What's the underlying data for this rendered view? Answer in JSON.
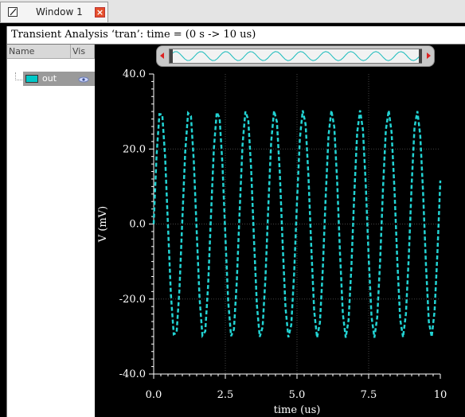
{
  "tab": {
    "label": "Window 1",
    "close_symbol": "×"
  },
  "window": {
    "title": "Transient Analysis ‘tran’: time = (0 s -> 10 us)"
  },
  "sidebar": {
    "columns": {
      "name": "Name",
      "vis": "Vis"
    },
    "traces": [
      {
        "name": "out",
        "color": "#00c7c7",
        "visible": true
      }
    ]
  },
  "icons": {
    "tab": "window-icon",
    "close": "close-icon",
    "visibility": "eye-icon"
  },
  "chart_data": {
    "type": "line",
    "title": "",
    "xlabel": "time (us)",
    "ylabel": "V (mV)",
    "xlim": [
      0,
      10
    ],
    "ylim": [
      -40,
      40
    ],
    "xticks": [
      0,
      2.5,
      5.0,
      7.5,
      10
    ],
    "xtick_labels": [
      "0.0",
      "2.5",
      "5.0",
      "7.5",
      "10"
    ],
    "yticks": [
      -40,
      -20,
      0,
      20,
      40
    ],
    "ytick_labels": [
      "-40.0",
      "-20.0",
      "0.0",
      "20.0",
      "40.0"
    ],
    "grid": true,
    "line_style": "dashed",
    "series": [
      {
        "name": "out",
        "color": "#22d3d3",
        "x": [
          0,
          0.1,
          0.2,
          0.3,
          0.4,
          0.5,
          0.6,
          0.7,
          0.8,
          0.9,
          1.0,
          1.1,
          1.2,
          1.3,
          1.4,
          1.5,
          1.6,
          1.7,
          1.8,
          1.9,
          2.0,
          2.1,
          2.2,
          2.3,
          2.4,
          2.5,
          2.6,
          2.7,
          2.8,
          2.9,
          3.0,
          3.1,
          3.2,
          3.3,
          3.4,
          3.5,
          3.6,
          3.7,
          3.8,
          3.9,
          4.0,
          4.1,
          4.2,
          4.3,
          4.4,
          4.5,
          4.6,
          4.7,
          4.8,
          4.9,
          5.0,
          5.1,
          5.2,
          5.3,
          5.4,
          5.5,
          5.6,
          5.7,
          5.8,
          5.9,
          6.0,
          6.1,
          6.2,
          6.3,
          6.4,
          6.5,
          6.6,
          6.7,
          6.8,
          6.9,
          7.0,
          7.1,
          7.2,
          7.3,
          7.4,
          7.5,
          7.6,
          7.7,
          7.8,
          7.9,
          8.0,
          8.1,
          8.2,
          8.3,
          8.4,
          8.5,
          8.6,
          8.7,
          8.8,
          8.9,
          9.0,
          9.1,
          9.2,
          9.3,
          9.4,
          9.5,
          9.6,
          9.7,
          9.8,
          9.9,
          10.0
        ],
        "y": [
          0.0,
          18.2,
          29.3,
          29.2,
          17.8,
          -0.6,
          -18.7,
          -29.4,
          -29.0,
          -17.3,
          1.2,
          19.2,
          29.6,
          28.8,
          16.8,
          -1.8,
          -19.7,
          -29.7,
          -28.6,
          -16.3,
          2.4,
          20.1,
          29.8,
          28.3,
          15.8,
          -3.0,
          -20.6,
          -29.9,
          -28.1,
          -15.3,
          3.6,
          21.1,
          30.0,
          27.8,
          14.8,
          -4.2,
          -21.5,
          -30.1,
          -27.5,
          -14.3,
          4.8,
          22.0,
          30.2,
          27.2,
          13.7,
          -5.4,
          -22.4,
          -30.2,
          -26.9,
          -13.2,
          5.9,
          22.8,
          30.3,
          26.6,
          12.7,
          -6.5,
          -23.2,
          -30.3,
          -26.3,
          -12.1,
          7.1,
          23.6,
          30.3,
          25.9,
          11.6,
          -7.7,
          -24.0,
          -30.3,
          -25.6,
          -11.0,
          8.2,
          24.4,
          30.3,
          25.2,
          10.4,
          -8.8,
          -24.7,
          -30.3,
          -24.8,
          -9.9,
          9.4,
          25.1,
          30.3,
          24.4,
          9.3,
          -9.9,
          -25.4,
          -30.2,
          -24.0,
          -8.7,
          10.5,
          25.8,
          30.1,
          23.6,
          8.2,
          -11.0,
          -26.1,
          -30.1,
          -23.2,
          -7.6,
          11.6
        ]
      }
    ]
  }
}
